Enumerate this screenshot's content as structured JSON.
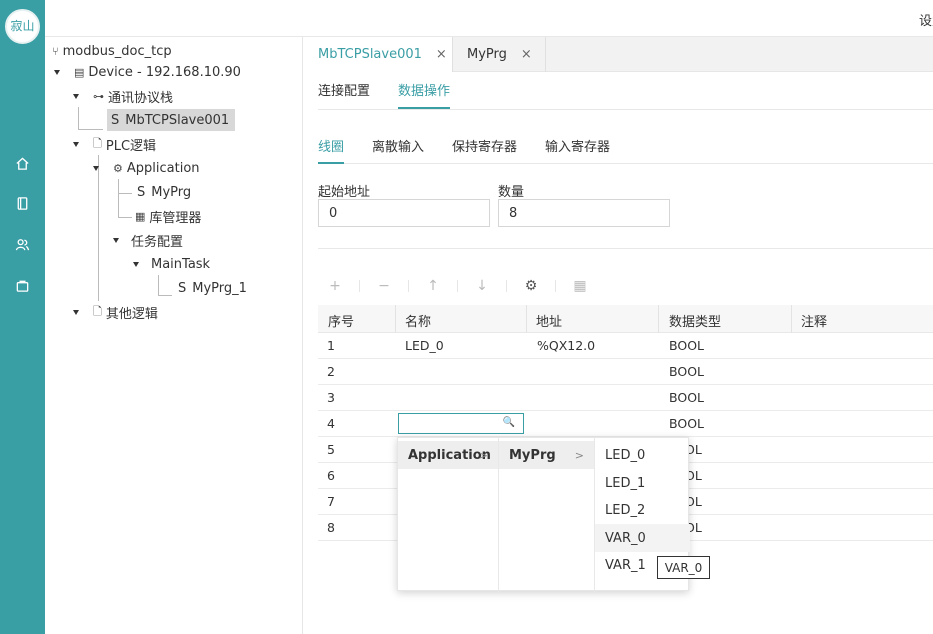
{
  "app": {
    "logo_text": "寂山",
    "settings_label": "设置"
  },
  "rail": {
    "icons": [
      "home-icon",
      "book-icon",
      "users-icon",
      "bag-icon"
    ]
  },
  "tree": {
    "root": "modbus_doc_tcp",
    "device": "Device - 192.168.10.90",
    "comm": "通讯协议栈",
    "slave": "MbTCPSlave001",
    "plc": "PLC逻辑",
    "application": "Application",
    "myprg": "MyPrg",
    "lib": "库管理器",
    "taskcfg": "任务配置",
    "maintask": "MainTask",
    "myprg1": "MyPrg_1",
    "other": "其他逻辑",
    "prefix_s": "S"
  },
  "tabs": [
    {
      "label": "MbTCPSlave001",
      "close": "×"
    },
    {
      "label": "MyPrg",
      "close": "×"
    }
  ],
  "subtabs": [
    "连接配置",
    "数据操作"
  ],
  "regtabs": [
    "线圈",
    "离散输入",
    "保持寄存器",
    "输入寄存器"
  ],
  "form": {
    "start_label": "起始地址",
    "start_value": "0",
    "count_label": "数量",
    "count_value": "8"
  },
  "toolbar": {
    "add": "+",
    "remove": "−",
    "up": "↑",
    "down": "↓",
    "gear": "⚙",
    "grid": "▦"
  },
  "table": {
    "headers": [
      "序号",
      "名称",
      "地址",
      "数据类型",
      "注释"
    ],
    "rows": [
      {
        "idx": "1",
        "name": "LED_0",
        "addr": "%QX12.0",
        "type": "BOOL"
      },
      {
        "idx": "2",
        "name": "",
        "addr": "",
        "type": "BOOL"
      },
      {
        "idx": "3",
        "name": "",
        "addr": "",
        "type": "BOOL"
      },
      {
        "idx": "4",
        "name": "",
        "addr": "",
        "type": "BOOL"
      },
      {
        "idx": "5",
        "name": "",
        "addr": "",
        "type": "OL"
      },
      {
        "idx": "6",
        "name": "",
        "addr": "",
        "type": "OL"
      },
      {
        "idx": "7",
        "name": "",
        "addr": "",
        "type": "OL"
      },
      {
        "idx": "8",
        "name": "",
        "addr": "",
        "type": "OL"
      }
    ]
  },
  "cascader": {
    "col1": [
      "Application"
    ],
    "col2": [
      "MyPrg"
    ],
    "col3": [
      "LED_0",
      "LED_1",
      "LED_2",
      "VAR_0",
      "VAR_1"
    ],
    "chevron": ">"
  },
  "tooltip": "VAR_0"
}
